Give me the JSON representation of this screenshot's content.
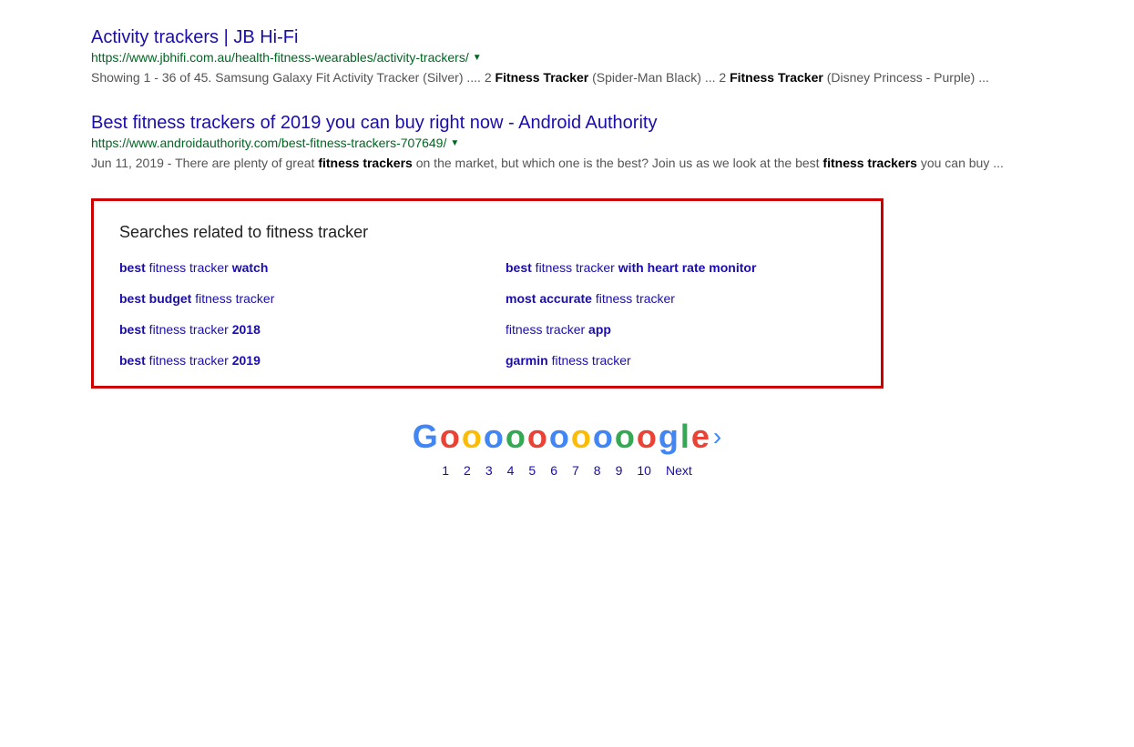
{
  "results": [
    {
      "id": "result-jbhifi",
      "title": "Activity trackers | JB Hi-Fi",
      "url": "https://www.jbhifi.com.au/health-fitness-wearables/activity-trackers/",
      "snippet_text": "Showing 1 - 36 of 45. Samsung Galaxy Fit Activity Tracker (Silver) .... 2 ",
      "snippet_bold1": "Fitness Tracker",
      "snippet_text2": " (Spider-Man Black) ... 2 ",
      "snippet_bold2": "Fitness Tracker",
      "snippet_text3": " (Disney Princess - Purple) ..."
    },
    {
      "id": "result-androidauthority",
      "title": "Best fitness trackers of 2019 you can buy right now - Android Authority",
      "url": "https://www.androidauthority.com/best-fitness-trackers-707649/",
      "date": "Jun 11, 2019",
      "snippet_text": " - There are plenty of great ",
      "snippet_bold1": "fitness trackers",
      "snippet_text2": " on the market, but which one is the best? Join us as we look at the best ",
      "snippet_bold2": "fitness trackers",
      "snippet_text3": " you can buy ..."
    }
  ],
  "related_searches": {
    "title": "Searches related to fitness tracker",
    "items": [
      {
        "bold": "best",
        "rest": " fitness tracker ",
        "bold2": "watch"
      },
      {
        "bold": "best",
        "rest": " fitness tracker ",
        "bold2": "with heart rate monitor"
      },
      {
        "bold": "best budget",
        "rest": " fitness tracker",
        "bold2": ""
      },
      {
        "bold": "most accurate",
        "rest": " fitness tracker",
        "bold2": ""
      },
      {
        "bold": "best",
        "rest": " fitness tracker ",
        "bold2": "2018"
      },
      {
        "bold": "fitness tracker ",
        "rest": "",
        "bold2": "app"
      },
      {
        "bold": "best",
        "rest": " fitness tracker ",
        "bold2": "2019"
      },
      {
        "bold": "garmin",
        "rest": " fitness tracker",
        "bold2": ""
      }
    ]
  },
  "google_logo": {
    "letters": [
      "G",
      "o",
      "o",
      "o",
      "o",
      "o",
      "o",
      "o",
      "o",
      "o",
      "o",
      "g",
      "l",
      "e"
    ]
  },
  "pagination": {
    "pages": [
      "1",
      "2",
      "3",
      "4",
      "5",
      "6",
      "7",
      "8",
      "9",
      "10"
    ],
    "next_label": "Next"
  }
}
